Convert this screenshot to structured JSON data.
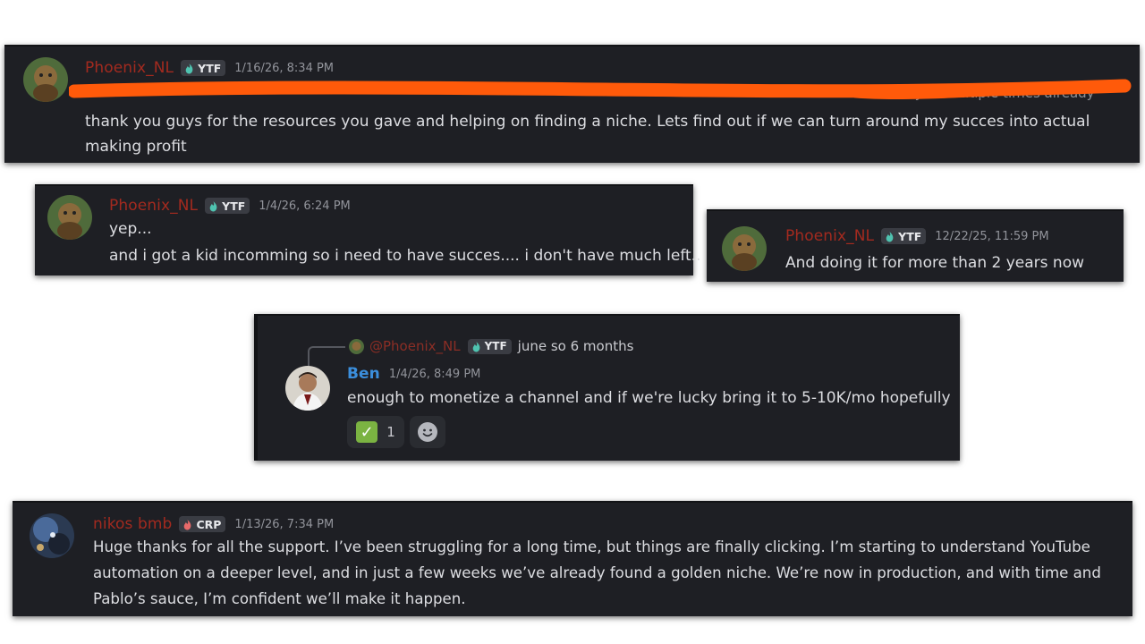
{
  "messages": {
    "m1": {
      "username": "Phoenix_NL",
      "tag": "YTF",
      "timestamp": "1/16/26, 8:34 PM",
      "line_visible_tail": "I told you multiple times already",
      "text": "thank you guys for the resources you gave and helping on finding a niche. Lets find out if we can turn around my succes into actual making profit"
    },
    "m2": {
      "username": "Phoenix_NL",
      "tag": "YTF",
      "timestamp": "1/4/26, 6:24 PM",
      "line1": "yep...",
      "line2": "and i got a kid incomming so i need to have succes.... i don't have much left.."
    },
    "m3": {
      "username": "Phoenix_NL",
      "tag": "YTF",
      "timestamp": "12/22/25, 11:59 PM",
      "text": "And doing it for more than 2 years now"
    },
    "m4": {
      "reply_to": {
        "username": "@Phoenix_NL",
        "tag": "YTF",
        "text": "june so 6 months"
      },
      "username": "Ben",
      "timestamp": "1/4/26, 8:49 PM",
      "text": "enough to monetize a channel and if we're lucky bring it to 5-10K/mo hopefully",
      "reaction": {
        "emoji": "check-mark",
        "count": "1"
      }
    },
    "m5": {
      "username": "nikos bmb",
      "tag": "CRP",
      "timestamp": "1/13/26, 7:34 PM",
      "line1": "Huge thanks for all the support. I’ve been struggling for a long time, but things are finally clicking. I’m starting to understand YouTube",
      "line2": "automation on a deeper level, and in just a few weeks we’ve already found a golden niche. We’re now in production, and with time and",
      "line3": "Pablo’s sauce, I’m confident we’ll make it happen."
    }
  },
  "colors": {
    "card_bg": "#1e1f24",
    "username_red": "#a32a1f",
    "username_blue": "#3b8edc",
    "redaction_orange": "#ff5a0a"
  }
}
